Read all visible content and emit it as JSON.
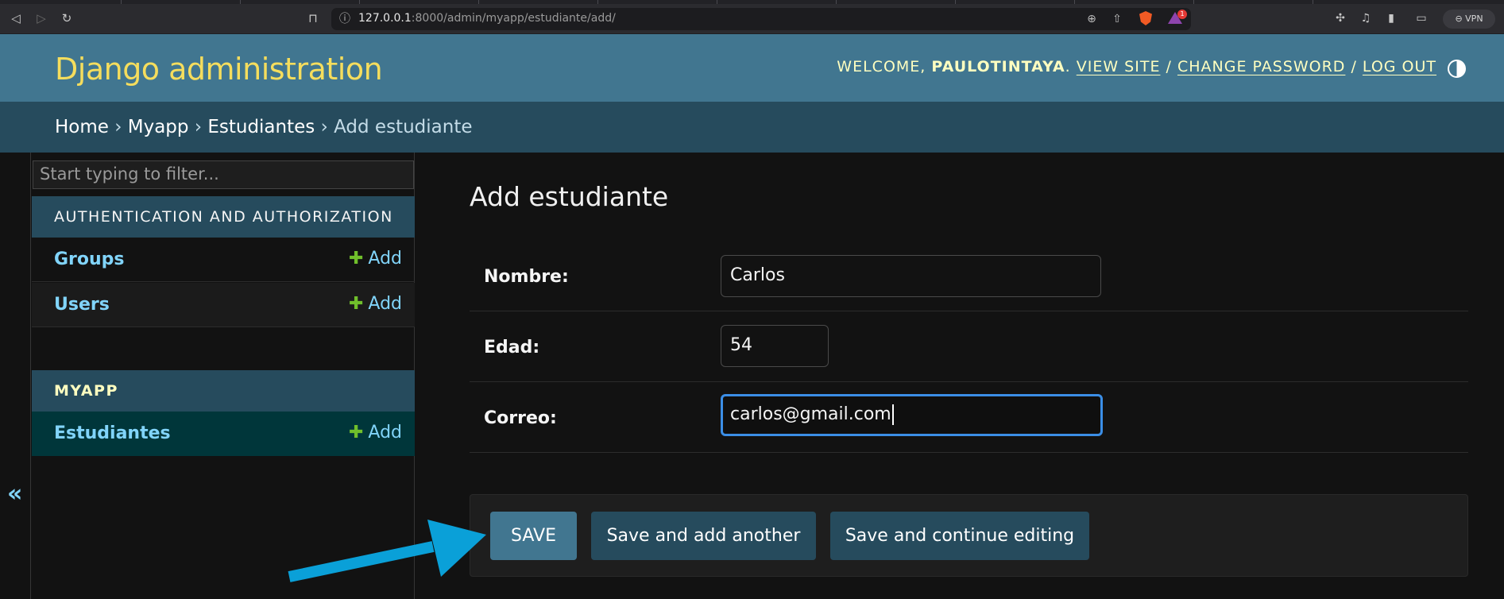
{
  "browser": {
    "url_host": "127.0.0.1",
    "url_rest": ":8000/admin/myapp/estudiante/add/",
    "vpn_label": "VPN",
    "notification_count": "1"
  },
  "header": {
    "site_title": "Django administration",
    "welcome": "WELCOME,",
    "username": "PAULOTINTAYA",
    "view_site": "VIEW SITE",
    "change_password": "CHANGE PASSWORD",
    "log_out": "LOG OUT"
  },
  "breadcrumbs": {
    "home": "Home",
    "app": "Myapp",
    "model": "Estudiantes",
    "current": "Add estudiante",
    "separator": "›"
  },
  "sidebar": {
    "filter_placeholder": "Start typing to filter...",
    "modules": [
      {
        "caption": "AUTHENTICATION AND AUTHORIZATION",
        "models": [
          {
            "name": "Groups",
            "add": "Add"
          },
          {
            "name": "Users",
            "add": "Add"
          }
        ]
      },
      {
        "caption": "MYAPP",
        "models": [
          {
            "name": "Estudiantes",
            "add": "Add"
          }
        ]
      }
    ],
    "collapse_label": "«"
  },
  "form": {
    "title": "Add estudiante",
    "fields": [
      {
        "label": "Nombre:",
        "value": "Carlos"
      },
      {
        "label": "Edad:",
        "value": "54"
      },
      {
        "label": "Correo:",
        "value": "carlos@gmail.com"
      }
    ],
    "buttons": {
      "save": "SAVE",
      "save_add_another": "Save and add another",
      "save_continue": "Save and continue editing"
    }
  },
  "colors": {
    "header_bg": "#417690",
    "breadcrumb_bg": "#264b5d",
    "site_title": "#f5dd5d",
    "link": "#81d4fa",
    "add_plus": "#70bf2b",
    "annotation_arrow": "#0aa0d8"
  }
}
